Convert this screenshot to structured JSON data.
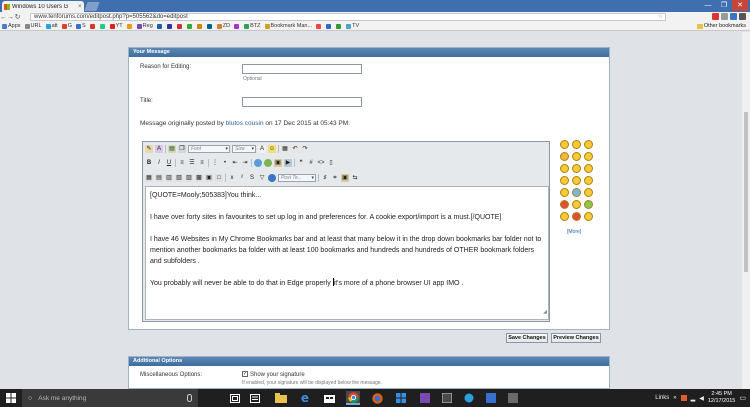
{
  "browser": {
    "tab_title": "Windows 10 Users G",
    "tab_close": "×",
    "url": "www.tenforums.com/editpost.php?p=505562&do=editpost",
    "window_buttons": [
      "—",
      "❐",
      "✕"
    ],
    "bookmarks": [
      {
        "label": "Apps",
        "color": "#4a7bd0"
      },
      {
        "label": "URL",
        "color": "#888888"
      },
      {
        "label": "att",
        "color": "#2aa0e0"
      },
      {
        "label": "G",
        "color": "#e04030"
      },
      {
        "label": "S",
        "color": "#3a6fd0"
      },
      {
        "label": "YT",
        "color": "#e02020"
      },
      {
        "label": "Reg",
        "color": "#7a4ab0"
      },
      {
        "label": "ZD",
        "color": "#d08030"
      },
      {
        "label": "BTZ",
        "color": "#30a050"
      },
      {
        "label": "Bookmark Man...",
        "color": "#d0a020"
      },
      {
        "label": "TV",
        "color": "#50a0d0"
      }
    ],
    "other_bookmarks": "Other bookmarks"
  },
  "your_message": {
    "header": "Your Message",
    "reason_label": "Reason for Editing:",
    "reason_value": "",
    "optional_note": "Optional",
    "title_label": "Title:",
    "title_value": "",
    "orig_prefix": "Message originally posted by",
    "orig_user": "blutos cousin",
    "orig_suffix": "on 17 Dec 2015 at 05:43 PM:"
  },
  "editor": {
    "font_select": "Font",
    "size_select": "Size",
    "post_template": "Post Te...",
    "content": {
      "p1": "[QUOTE=Mooly;505383]You think...",
      "p2": "I have over forty sites in favourites to set up log in and preferences for. A cookie export/import is a must.[/QUOTE]",
      "p3": "I have 46 Websites in My Chrome Bookmarks bar and at least that many below it in the drop down bookmarks bar folder not to mention another bookmarks ba folder with at least 100 bookmarks and hundreds and hundreds of OTHER bookmark folders and subfolders .",
      "p4a": "You probably will never be able to do that in Edge properly ",
      "p4b": "it's more of a phone browser UI app IMO ."
    }
  },
  "smilies": {
    "more_label": "[More]"
  },
  "buttons": {
    "save": "Save Changes",
    "preview": "Preview Changes"
  },
  "additional": {
    "header": "Additional Options",
    "misc_label": "Miscellaneous Options:",
    "show_sig_label": "Show your signature",
    "show_sig_checked": true,
    "show_sig_note": "If enabled, your signature will be displayed below the message."
  },
  "taskbar": {
    "search_placeholder": "Ask me anything",
    "tray_links": "Links",
    "time": "2:45 PM",
    "date": "12/17/2015"
  }
}
